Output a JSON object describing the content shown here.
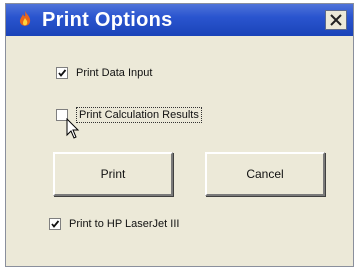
{
  "window": {
    "title": "Print Options"
  },
  "options": {
    "print_data_input": {
      "label": "Print Data Input",
      "checked": true
    },
    "print_calculation_results": {
      "label": "Print Calculation Results",
      "checked": false
    },
    "print_to_printer": {
      "label": "Print to HP LaserJet III",
      "checked": true
    }
  },
  "buttons": {
    "print": "Print",
    "cancel": "Cancel"
  },
  "icons": {
    "app": "flame-icon",
    "close": "close-icon",
    "cursor": "mouse-cursor"
  },
  "colors": {
    "titlebar": "#2a55cf",
    "window_bg": "#ece9d8"
  }
}
